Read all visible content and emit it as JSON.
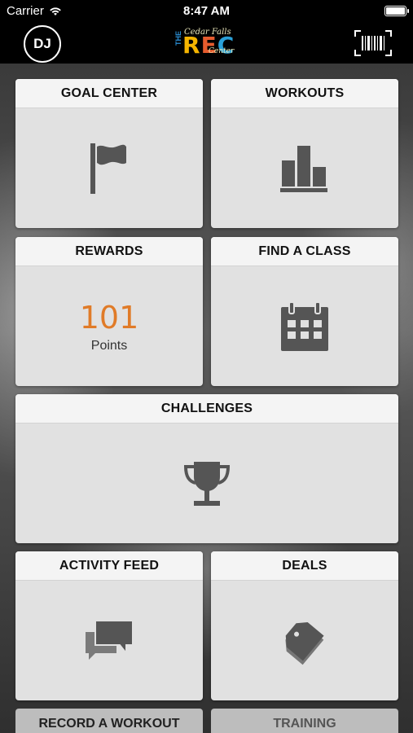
{
  "status": {
    "carrier": "Carrier",
    "time": "8:47 AM"
  },
  "header": {
    "avatar_initials": "DJ",
    "logo": {
      "the": "THE",
      "rec_r": "R",
      "rec_e": "E",
      "rec_c": "C",
      "script_top": "Cedar Falls",
      "script_bottom": "Center"
    }
  },
  "tiles": {
    "goal_center": "GOAL CENTER",
    "workouts": "WORKOUTS",
    "rewards": "REWARDS",
    "rewards_points_value": "101",
    "rewards_points_label": "Points",
    "find_a_class": "FIND A CLASS",
    "challenges": "CHALLENGES",
    "activity_feed": "ACTIVITY FEED",
    "deals": "DEALS",
    "record_a_workout": "RECORD A WORKOUT",
    "training": "TRAINING"
  },
  "icons": {
    "goal_center": "flag-icon",
    "workouts": "bar-chart-icon",
    "find_a_class": "calendar-icon",
    "challenges": "trophy-icon",
    "activity_feed": "chat-bubbles-icon",
    "deals": "tag-icon",
    "scanner": "barcode-icon",
    "wifi": "wifi-icon",
    "battery": "battery-icon"
  },
  "colors": {
    "points_accent": "#e07b28",
    "icon_gray": "#555555",
    "tile_header": "#f4f4f4",
    "tile_body": "#e1e1e1"
  }
}
